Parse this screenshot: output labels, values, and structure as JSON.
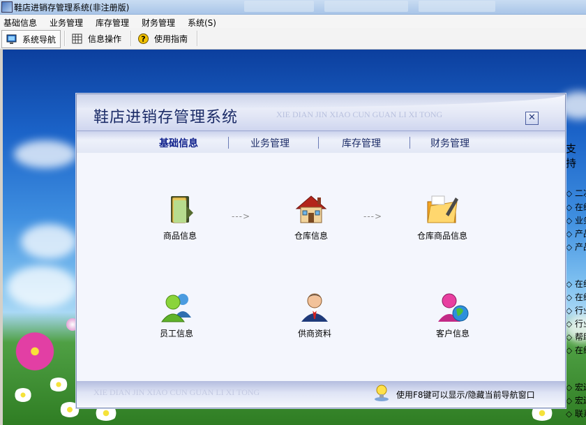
{
  "window": {
    "title": "鞋店进销存管理系统(非注册版)"
  },
  "menu": {
    "items": [
      "基础信息",
      "业务管理",
      "库存管理",
      "财务管理",
      "系统(S)"
    ]
  },
  "toolbar": {
    "buttons": [
      {
        "label": "系统导航",
        "icon": "monitor-icon"
      },
      {
        "label": "信息操作",
        "icon": "grid-icon"
      },
      {
        "label": "使用指南",
        "icon": "help-icon"
      }
    ]
  },
  "sidebar_right": {
    "title": "支持",
    "items": [
      "二次",
      "在约",
      "业务",
      "产品",
      "产品",
      "在约",
      "在约",
      "行业",
      "行业",
      "帮助",
      "在约",
      "宏边",
      "宏边",
      "联系"
    ]
  },
  "dialog": {
    "title": "鞋店进销存管理系统",
    "subtitle": "XIE DIAN JIN XIAO CUN GUAN LI XI TONG",
    "close_glyph": "✕",
    "tabs": [
      "基础信息",
      "业务管理",
      "库存管理",
      "财务管理"
    ],
    "active_tab": "基础信息",
    "modules": [
      {
        "label": "商品信息",
        "icon": "folder-icon"
      },
      {
        "label": "仓库信息",
        "icon": "house-icon"
      },
      {
        "label": "仓库商品信息",
        "icon": "folder-pen-icon"
      },
      {
        "label": "员工信息",
        "icon": "users-icon"
      },
      {
        "label": "供商资料",
        "icon": "businessman-icon"
      },
      {
        "label": "客户信息",
        "icon": "globe-users-icon"
      }
    ],
    "arrow": "--->",
    "footer": {
      "watermark": "XIE DIAN JIN XIAO CUN GUAN LI XI TONG",
      "hint": "使用F8键可以显示/隐藏当前导航窗口"
    }
  },
  "colors": {
    "accent": "#1b2b67",
    "header": "#e4e8f6",
    "body": "#f4f6fd"
  }
}
